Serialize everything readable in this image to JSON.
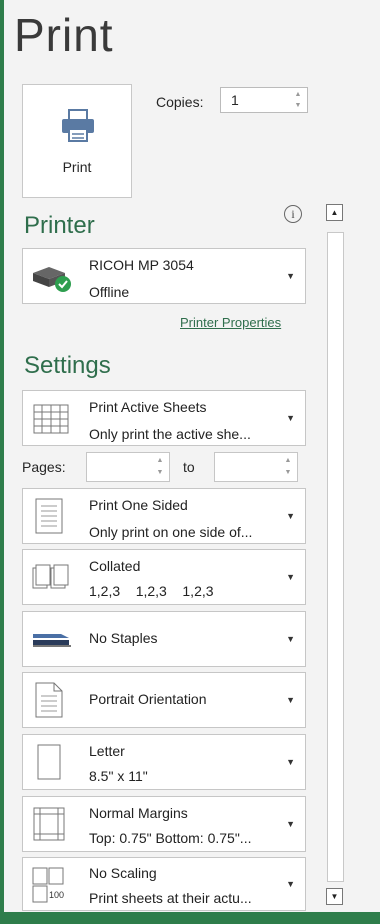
{
  "title": "Print",
  "print_button": {
    "label": "Print"
  },
  "copies": {
    "label": "Copies:",
    "value": "1"
  },
  "printer": {
    "heading": "Printer",
    "name": "RICOH MP 3054",
    "status": "Offline",
    "properties_link": "Printer Properties"
  },
  "settings": {
    "heading": "Settings",
    "what": {
      "l1": "Print Active Sheets",
      "l2": "Only print the active she..."
    },
    "pages_label": "Pages:",
    "to_label": "to",
    "sided": {
      "l1": "Print One Sided",
      "l2": "Only print on one side of..."
    },
    "collated": {
      "l1": "Collated",
      "l2": "1,2,3    1,2,3    1,2,3"
    },
    "staples": {
      "l1": "No Staples"
    },
    "orientation": {
      "l1": "Portrait Orientation"
    },
    "paper": {
      "l1": "Letter",
      "l2": "8.5\" x 11\""
    },
    "margins": {
      "l1": "Normal Margins",
      "l2": "Top: 0.75\" Bottom: 0.75\"..."
    },
    "scaling": {
      "l1": "No Scaling",
      "l2": "Print sheets at their actu...",
      "icon_text": "100"
    }
  },
  "colors": {
    "accent_green": "#2f6e4c",
    "frame_green": "#2e7d4b",
    "status_ok": "#2e9e4f"
  }
}
